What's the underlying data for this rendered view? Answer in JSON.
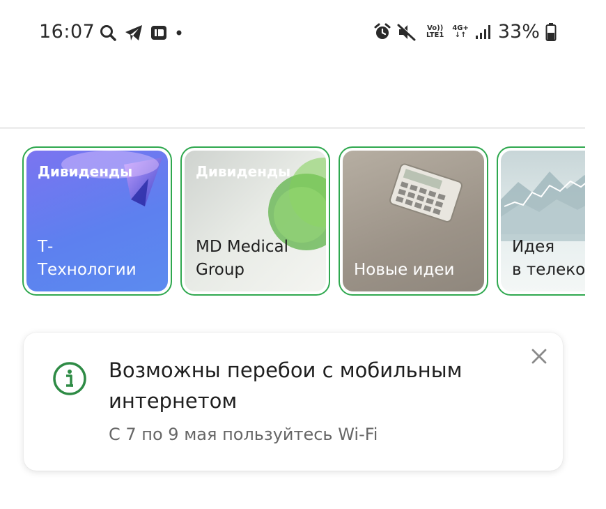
{
  "status_bar": {
    "time": "16:07",
    "left_icons": [
      "search-icon",
      "telegram-icon",
      "cast-icon",
      "dot-icon"
    ],
    "right_icons": [
      "alarm-icon",
      "mute-icon",
      "volte-icon",
      "network-4g-icon",
      "signal-icon",
      "battery-icon"
    ],
    "volte_top": "Vo))",
    "volte_bottom": "LTE1",
    "net_top": "4G+",
    "net_bottom": "↓↑",
    "battery": "33%"
  },
  "stories": [
    {
      "tag": "Дивиденды",
      "title": "Т-\nТехнологии"
    },
    {
      "tag": "Дивиденды",
      "title": "MD Medical\nGroup"
    },
    {
      "tag": "",
      "title": "Новые идеи"
    },
    {
      "tag": "",
      "title": "Идея\nв телеко"
    }
  ],
  "notice": {
    "icon": "info-icon",
    "title": "Возможны перебои с мобильным интернетом",
    "subtitle": "С 7 по 9 мая пользуйтесь Wi-Fi"
  },
  "colors": {
    "story_border": "#2fa84f",
    "info_icon": "#2e8b45"
  }
}
